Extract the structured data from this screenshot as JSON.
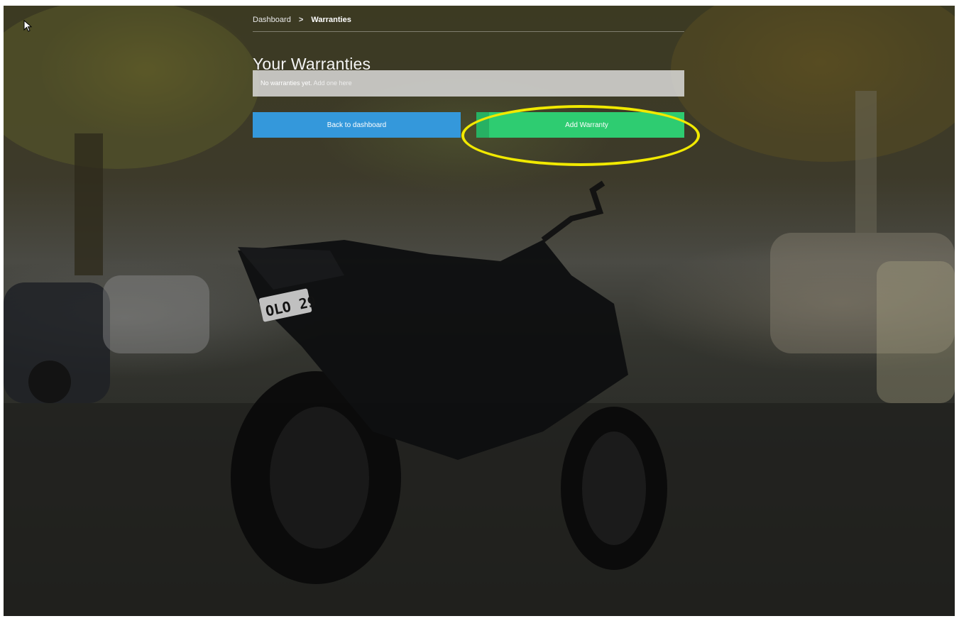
{
  "breadcrumb": {
    "items": [
      {
        "label": "Dashboard"
      },
      {
        "label": "Warranties"
      }
    ],
    "separator": ">"
  },
  "page": {
    "title": "Your Warranties"
  },
  "empty_state": {
    "message": "No warranties yet.",
    "link_label": "Add one here"
  },
  "actions": {
    "back_label": "Back to dashboard",
    "add_label": "Add Warranty"
  },
  "background": {
    "license_plate": "OLO 29"
  },
  "colors": {
    "back_button": "#3498db",
    "add_button": "#2ecc71",
    "highlight": "#f1e900"
  }
}
